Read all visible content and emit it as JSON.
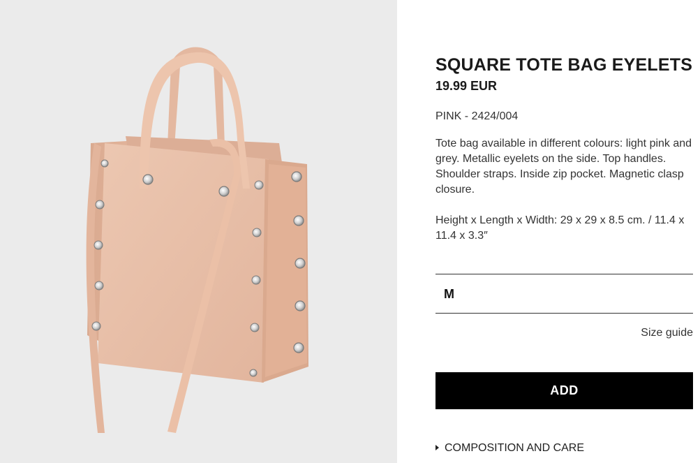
{
  "product": {
    "title": "SQUARE TOTE BAG EYELETS",
    "price": "19.99 EUR",
    "colour_ref": "PINK - 2424/004",
    "description": "Tote bag available in different colours: light pink and grey. Metallic eyelets on the side. Top handles. Shoulder straps. Inside zip pocket. Magnetic clasp closure.",
    "dimensions": "Height x Length x Width: 29 x 29 x 8.5 cm. / 11.4 x 11.4 x 3.3″"
  },
  "size_selector": {
    "selected": "M"
  },
  "size_guide_label": "Size guide",
  "add_button_label": "ADD",
  "composition_label": "COMPOSITION AND CARE",
  "image": {
    "subject": "pink square tote bag with metallic eyelets",
    "bag_color": "#e8bfa8",
    "background_color": "#ebebeb"
  }
}
